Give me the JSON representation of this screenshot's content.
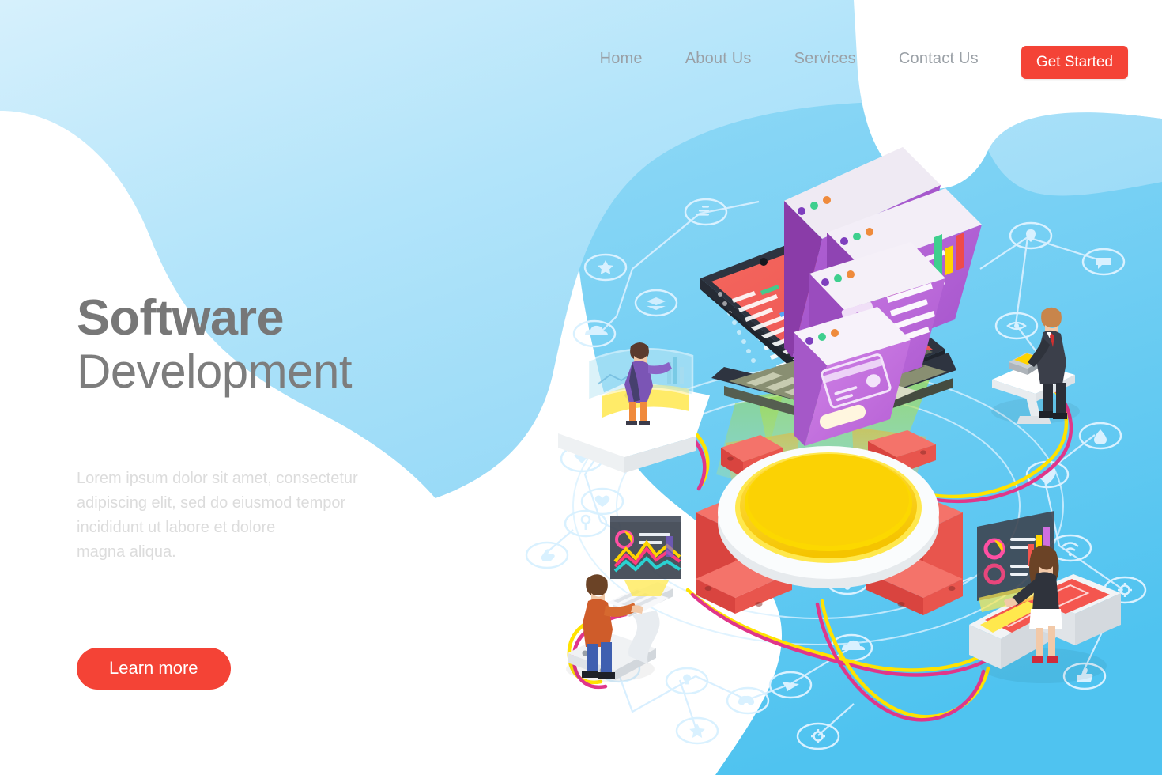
{
  "theme": {
    "accent_red": "#f44336",
    "sky_blue": "#5ec8f2",
    "pale_blue": "#bfe6fa",
    "heading_gray": "#777777",
    "body_gray": "#dcdcdc",
    "nav_gray": "#9aa0a6"
  },
  "nav": {
    "links": [
      {
        "label": "Home",
        "name": "nav-link-home"
      },
      {
        "label": "About Us",
        "name": "nav-link-about-us"
      },
      {
        "label": "Services",
        "name": "nav-link-services"
      },
      {
        "label": "Contact Us",
        "name": "nav-link-contact-us"
      }
    ],
    "cta_label": "Get Started"
  },
  "hero": {
    "title_bold": "Software",
    "title_light": "Development",
    "paragraph": "Lorem ipsum dolor sit amet, consectetur\nadipiscing elit, sed do eiusmod tempor\nincididunt ut labore et dolore\nmagna aliqua.",
    "button_label": "Learn more"
  },
  "illustration": {
    "description": "Isometric flat vector scene: an open laptop showing red code editor, with four floating purple browser windows (binary code, analytics dashboard, user profile, payment card) rising above it. Below sits a large red-and-yellow gear / cog platform emitting colored light beams. Four workers are connected to it by colored cables.",
    "laptop": {
      "name": "laptop",
      "screen_content": "code-editor",
      "screen_color": "#f2564f"
    },
    "floating_windows": [
      {
        "name": "window-binary-code",
        "content": "binary-code",
        "color": "#a855c8"
      },
      {
        "name": "window-analytics",
        "content": "charts-dashboard",
        "color": "#b057cf"
      },
      {
        "name": "window-user-profile",
        "content": "user-profile",
        "color": "#bf62d6"
      },
      {
        "name": "window-payment-card",
        "content": "credit-card",
        "color": "#cb6ddd"
      }
    ],
    "gear": {
      "name": "gear-platform",
      "body_color": "#ef5b52",
      "disc_color": "#f7cb15"
    },
    "characters": [
      {
        "name": "character-curved-screens",
        "role": "data analyst at curved holographic panels"
      },
      {
        "name": "character-businessman-laptop",
        "role": "businessman in dark suit at pedestal desk"
      },
      {
        "name": "character-developer-desk",
        "role": "developer in orange sweater typing at keyboard"
      },
      {
        "name": "character-woman-dashboard",
        "role": "woman interacting with dashboard screen"
      }
    ],
    "network_icons": [
      "chart-bars-icon",
      "star-icon",
      "layers-icon",
      "cloud-upload-icon",
      "gem-icon",
      "heart-icon",
      "key-icon",
      "bulb-icon",
      "gear-icon",
      "share-icon",
      "cloud-icon",
      "eye-icon",
      "pin-icon",
      "paper-plane-icon",
      "bar-chart-icon",
      "game-controller-icon",
      "thumbs-up-icon",
      "wifi-icon",
      "settings-icon",
      "droplet-icon",
      "message-icon",
      "rocket-icon"
    ]
  }
}
